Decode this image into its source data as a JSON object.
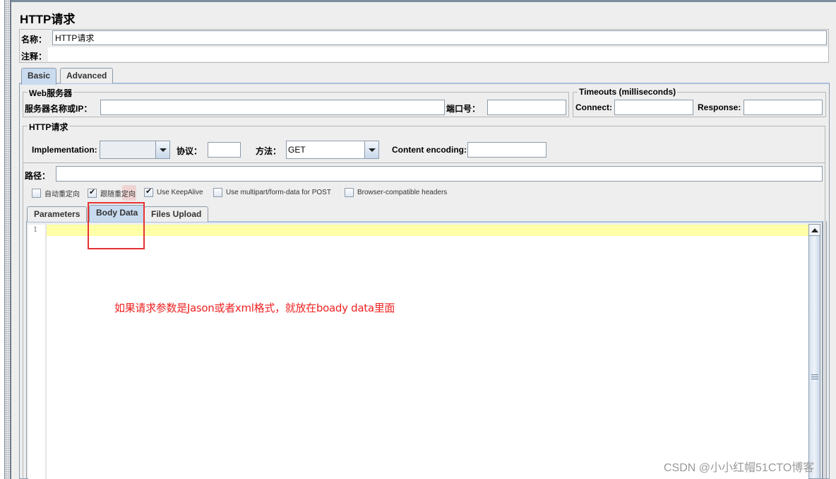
{
  "page": {
    "title": "HTTP请求"
  },
  "name_panel": {
    "name_label": "名称：",
    "name_value": "HTTP请求",
    "comment_label": "注释：",
    "comment_value": ""
  },
  "outer_tabs": [
    {
      "label": "Basic",
      "active": true
    },
    {
      "label": "Advanced",
      "active": false
    }
  ],
  "web_server": {
    "title": "Web服务器",
    "server_label": "服务器名称或IP：",
    "server_value": "",
    "port_label": "端口号：",
    "port_value": ""
  },
  "timeouts": {
    "title": "Timeouts (milliseconds)",
    "connect_label": "Connect:",
    "connect_value": "",
    "response_label": "Response:",
    "response_value": ""
  },
  "http_request": {
    "title": "HTTP请求",
    "implementation_label": "Implementation:",
    "implementation_value": "",
    "protocol_label": "协议：",
    "protocol_value": "",
    "method_label": "方法：",
    "method_value": "GET",
    "encoding_label": "Content encoding:",
    "encoding_value": "",
    "path_label": "路径：",
    "path_value": ""
  },
  "checkboxes": [
    {
      "label": "自动重定向",
      "checked": false
    },
    {
      "label": "跟随重定向",
      "checked": true
    },
    {
      "label": "Use KeepAlive",
      "checked": true
    },
    {
      "label": "Use multipart/form-data for POST",
      "checked": false
    },
    {
      "label": "Browser-compatible headers",
      "checked": false
    }
  ],
  "inner_tabs": [
    {
      "label": "Parameters",
      "active": false
    },
    {
      "label": "Body Data",
      "active": true
    },
    {
      "label": "Files Upload",
      "active": false
    }
  ],
  "editor": {
    "line_numbers": [
      "1"
    ],
    "content": ""
  },
  "annotation": {
    "text": "如果请求参数是Jason或者xml格式，就放在boady data里面",
    "color": "#ee2222"
  },
  "watermark": "CSDN @小小红帽51CTO博客",
  "colors": {
    "active_tab": "#c9dbef",
    "current_line": "#ffffa8",
    "border": "#8c9bab"
  }
}
